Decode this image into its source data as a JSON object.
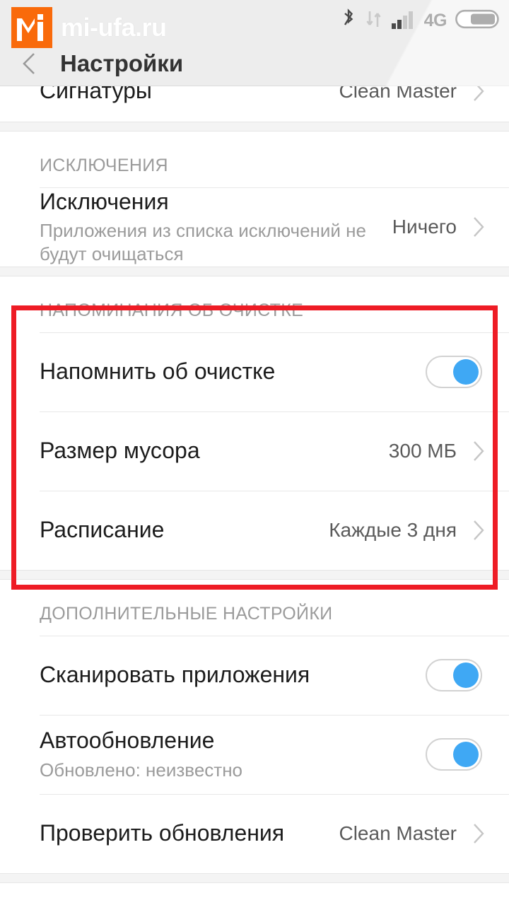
{
  "statusbar": {
    "icons": [
      "bluetooth-icon",
      "data-transfer-icon",
      "signal-bars-icon"
    ],
    "network_label": "4G",
    "battery": "battery-icon"
  },
  "titlebar": {
    "back": "back-arrow-icon",
    "title": "Настройки"
  },
  "watermark": {
    "text": "mi-ufa.ru",
    "badge_color": "#f96a0b"
  },
  "highlight": {
    "color": "#ee1c25",
    "target_section": "НАПОМИНАНИЯ ОБ ОЧИСТКЕ"
  },
  "colors": {
    "accent_toggle": "#3fa8f4",
    "header_bg": "#ededed",
    "section_gap": "#f4f4f4",
    "row_title": "#1c1c1c",
    "row_value": "#5a5a5a",
    "muted": "#9b9b9b"
  },
  "clipped_row": {
    "title": "Сигнатуры",
    "value": "Clean Master"
  },
  "sections": [
    {
      "header": "ИСКЛЮЧЕНИЯ",
      "rows": [
        {
          "title": "Исключения",
          "subtitle": "Приложения из списка исключений не будут очищаться",
          "value": "Ничего",
          "control": "chevron"
        }
      ]
    },
    {
      "header": "НАПОМИНАНИЯ ОБ ОЧИСТКЕ",
      "rows": [
        {
          "title": "Напомнить об очистке",
          "subtitle": "",
          "value": "",
          "control": "toggle",
          "toggle_state": "on"
        },
        {
          "title": "Размер мусора",
          "subtitle": "",
          "value": "300 МБ",
          "control": "chevron"
        },
        {
          "title": "Расписание",
          "subtitle": "",
          "value": "Каждые 3 дня",
          "control": "chevron"
        }
      ]
    },
    {
      "header": "ДОПОЛНИТЕЛЬНЫЕ НАСТРОЙКИ",
      "rows": [
        {
          "title": "Сканировать приложения",
          "subtitle": "",
          "value": "",
          "control": "toggle",
          "toggle_state": "on"
        },
        {
          "title": "Автообновление",
          "subtitle": "Обновлено: неизвестно",
          "value": "",
          "control": "toggle",
          "toggle_state": "on"
        },
        {
          "title": "Проверить обновления",
          "subtitle": "",
          "value": "Clean Master",
          "control": "chevron"
        }
      ]
    }
  ]
}
